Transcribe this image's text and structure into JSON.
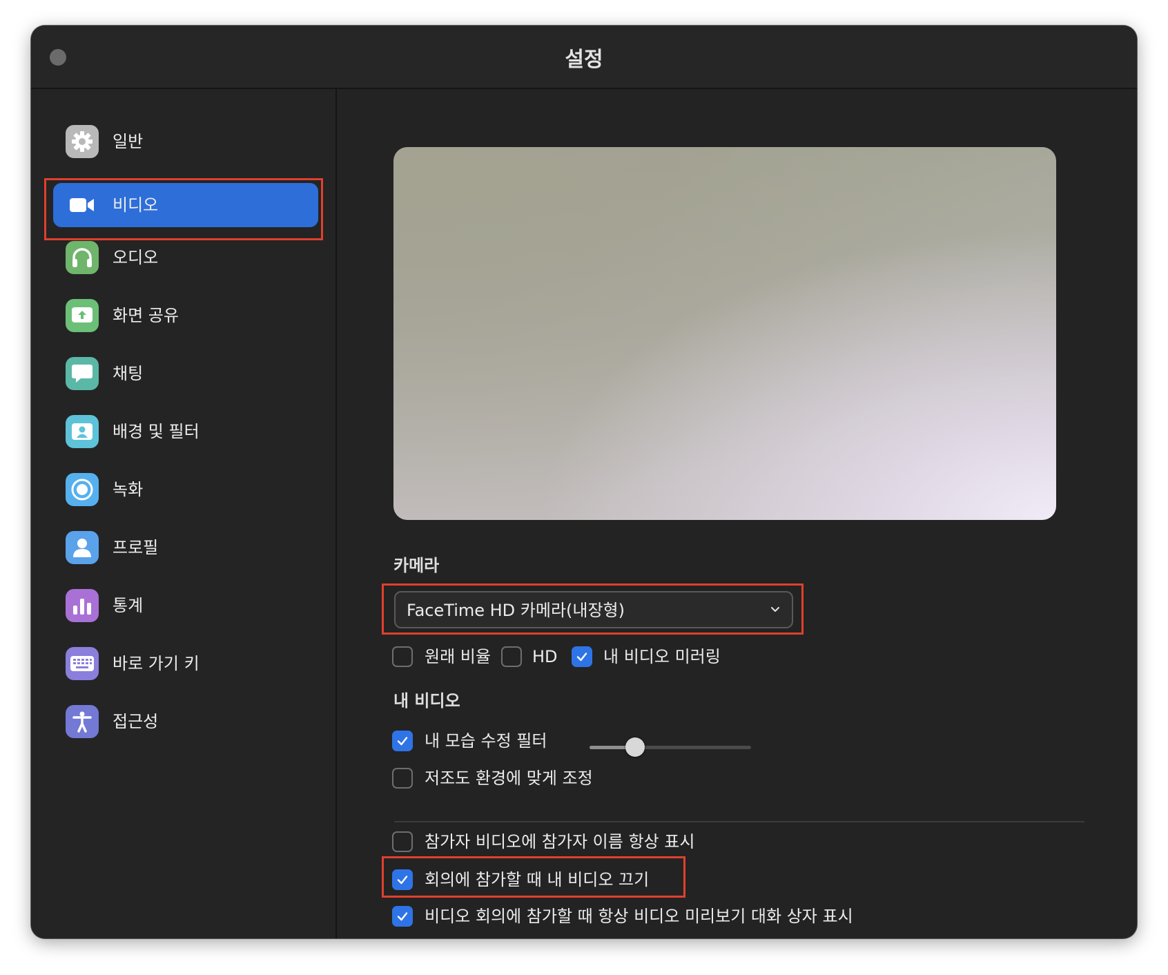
{
  "window": {
    "title": "설정"
  },
  "sidebar": {
    "items": [
      {
        "label": "일반",
        "icon": "gear-icon",
        "color": "#b9b9b9"
      },
      {
        "label": "비디오",
        "icon": "video-camera-icon",
        "color": "#2d6ed9",
        "active": true
      },
      {
        "label": "오디오",
        "icon": "headphones-icon",
        "color": "#6fb56b"
      },
      {
        "label": "화면 공유",
        "icon": "share-screen-icon",
        "color": "#6cbf77"
      },
      {
        "label": "채팅",
        "icon": "chat-bubble-icon",
        "color": "#5bb8a6"
      },
      {
        "label": "배경 및 필터",
        "icon": "background-person-icon",
        "color": "#5ec2d9"
      },
      {
        "label": "녹화",
        "icon": "record-icon",
        "color": "#56b0ee"
      },
      {
        "label": "프로필",
        "icon": "profile-icon",
        "color": "#5aa2ea"
      },
      {
        "label": "통계",
        "icon": "statistics-icon",
        "color": "#a971d6"
      },
      {
        "label": "바로 가기 키",
        "icon": "keyboard-icon",
        "color": "#8a7fdc"
      },
      {
        "label": "접근성",
        "icon": "accessibility-icon",
        "color": "#7379d4"
      }
    ]
  },
  "camera": {
    "heading": "카메라",
    "selected": "FaceTime HD 카메라(내장형)",
    "options": [
      {
        "label": "원래 비율",
        "checked": false
      },
      {
        "label": "HD",
        "checked": false
      },
      {
        "label": "내 비디오 미러링",
        "checked": true
      }
    ]
  },
  "my_video": {
    "heading": "내 비디오",
    "touch_up": {
      "label": "내 모습 수정 필터",
      "checked": true,
      "slider_value": 0.28
    },
    "low_light": {
      "label": "저조도 환경에 맞게 조정",
      "checked": false
    }
  },
  "meeting_options": [
    {
      "label": "참가자 비디오에 참가자 이름 항상 표시",
      "checked": false
    },
    {
      "label": "회의에 참가할 때 내 비디오 끄기",
      "checked": true
    },
    {
      "label": "비디오 회의에 참가할 때 항상 비디오 미리보기 대화 상자 표시",
      "checked": true
    }
  ],
  "colors": {
    "accent": "#2f74e6",
    "highlight_box": "#e0402c",
    "window_bg": "#232323"
  }
}
